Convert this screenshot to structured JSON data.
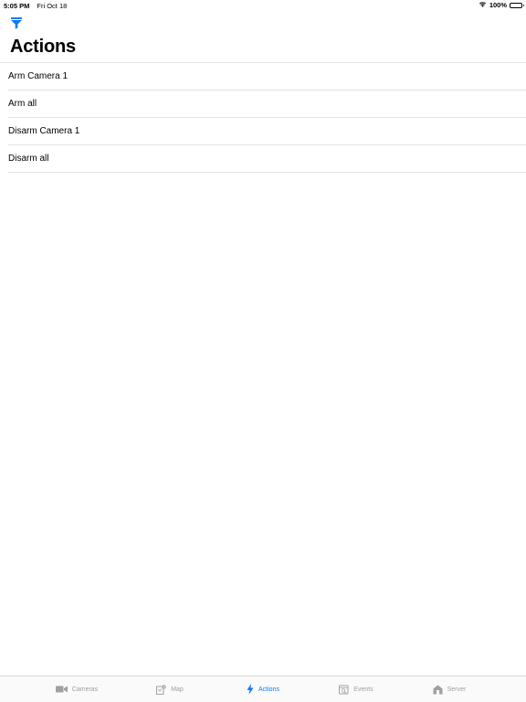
{
  "status_bar": {
    "time": "5:05 PM",
    "date": "Fri Oct 18",
    "battery": "100%"
  },
  "nav": {
    "title": "Actions",
    "filter_icon": "filter-icon"
  },
  "actions": [
    {
      "label": "Arm Camera 1"
    },
    {
      "label": "Arm all"
    },
    {
      "label": "Disarm Camera 1"
    },
    {
      "label": "Disarm all"
    }
  ],
  "tabs": [
    {
      "label": "Cameras",
      "icon": "video-camera-icon",
      "active": false
    },
    {
      "label": "Map",
      "icon": "map-icon",
      "active": false
    },
    {
      "label": "Actions",
      "icon": "lightning-bolt-icon",
      "active": true
    },
    {
      "label": "Events",
      "icon": "events-icon",
      "active": false
    },
    {
      "label": "Server",
      "icon": "server-house-icon",
      "active": false
    }
  ],
  "colors": {
    "accent": "#0a7aff",
    "inactive_tab": "#a0a0a3",
    "separator": "#e2e2e4"
  }
}
